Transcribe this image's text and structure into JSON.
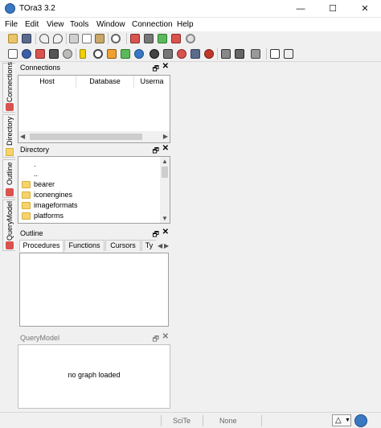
{
  "window": {
    "title": "TOra3 3.2",
    "minimize": "—",
    "maximize": "☐",
    "close": "✕"
  },
  "menubar": {
    "items": [
      "File",
      "Edit",
      "View",
      "Tools",
      "Window",
      "Connection",
      "Help"
    ]
  },
  "sidetabs": {
    "items": [
      "Connections",
      "Directory",
      "Outline",
      "QueryModel"
    ]
  },
  "connections": {
    "title": "Connections",
    "columns": [
      "Host",
      "Database",
      "Userna"
    ]
  },
  "directory": {
    "title": "Directory",
    "entries": [
      ".",
      "..",
      "bearer",
      "iconengines",
      "imageformats",
      "platforms"
    ]
  },
  "outline": {
    "title": "Outline",
    "tabs": [
      "Procedures",
      "Functions",
      "Cursors",
      "Ty"
    ]
  },
  "querymodel": {
    "title": "QueryModel",
    "message": "no graph loaded"
  },
  "statusbar": {
    "lexer": "SciTe",
    "mode": "None"
  },
  "controls": {
    "float": "🗗",
    "close": "✕"
  }
}
